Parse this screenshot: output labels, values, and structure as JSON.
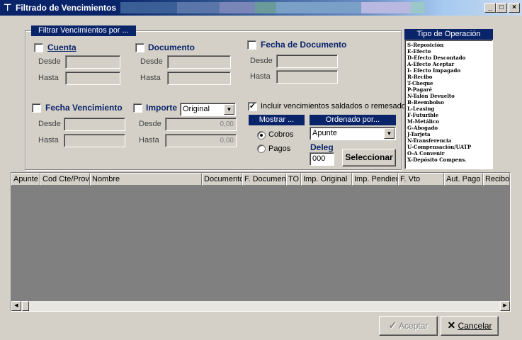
{
  "window": {
    "title": "Filtrado de Vencimientos",
    "minimize": "_",
    "maximize": "□",
    "close": "×"
  },
  "filter_group": {
    "title": "Filtrar Vencimientos por ...",
    "cuenta": {
      "label": "Cuenta",
      "checked": false,
      "desde_label": "Desde",
      "hasta_label": "Hasta",
      "desde_value": "",
      "hasta_value": ""
    },
    "documento": {
      "label": "Documento",
      "checked": false,
      "desde_label": "Desde",
      "hasta_label": "Hasta",
      "desde_value": "",
      "hasta_value": ""
    },
    "fecha_documento": {
      "label": "Fecha de Documento",
      "checked": false,
      "desde_label": "Desde",
      "hasta_label": "Hasta",
      "desde_value": "",
      "hasta_value": ""
    },
    "fecha_vencimiento": {
      "label": "Fecha Vencimiento",
      "checked": false,
      "desde_label": "Desde",
      "hasta_label": "Hasta",
      "desde_value": "",
      "hasta_value": ""
    },
    "importe": {
      "label": "Importe",
      "checked": false,
      "select_value": "Original",
      "desde_label": "Desde",
      "hasta_label": "Hasta",
      "desde_value": "0,00",
      "hasta_value": "0,00"
    },
    "incluir": {
      "label": "Incluir vencimientos saldados o remesados",
      "checked": true,
      "mark": "✓"
    },
    "mostrar": {
      "title": "Mostrar ...",
      "options": [
        "Cobros",
        "Pagos"
      ],
      "selected": "Cobros"
    },
    "ordenado": {
      "title": "Ordenado por...",
      "value": "Apunte"
    },
    "deleg": {
      "label": "Deleg",
      "value": "000"
    },
    "seleccionar_label": "Seleccionar"
  },
  "tipo_operacion": {
    "title": "Tipo de Operación",
    "items": [
      "S-Reposición",
      "E-Efecto",
      "D-Efecto Descontado",
      "A-Efecto Aceptar",
      "I- Efecto Impagado",
      "R-Recibo",
      "T-Cheque",
      "P-Pagaré",
      "N-Talón Devuelto",
      "B-Reembolso",
      "L-Leasing",
      "F-Futurible",
      "M-Metálico",
      "G-Abogado",
      "J-Tarjeta",
      "N-Transferencia",
      "U-Compensación/UATP",
      "O-A Convenir",
      "X-Depósito Compens."
    ]
  },
  "grid": {
    "columns": [
      "Apunte",
      "Cod Cte/Prov",
      "Nombre",
      "Documento",
      "F. Document",
      "TO",
      "Imp. Original",
      "Imp. Pendien",
      "F. Vto",
      "Aut. Pago",
      "Recibo"
    ]
  },
  "footer": {
    "accept_label": "Aceptar",
    "cancel_label": "Cancelar"
  }
}
